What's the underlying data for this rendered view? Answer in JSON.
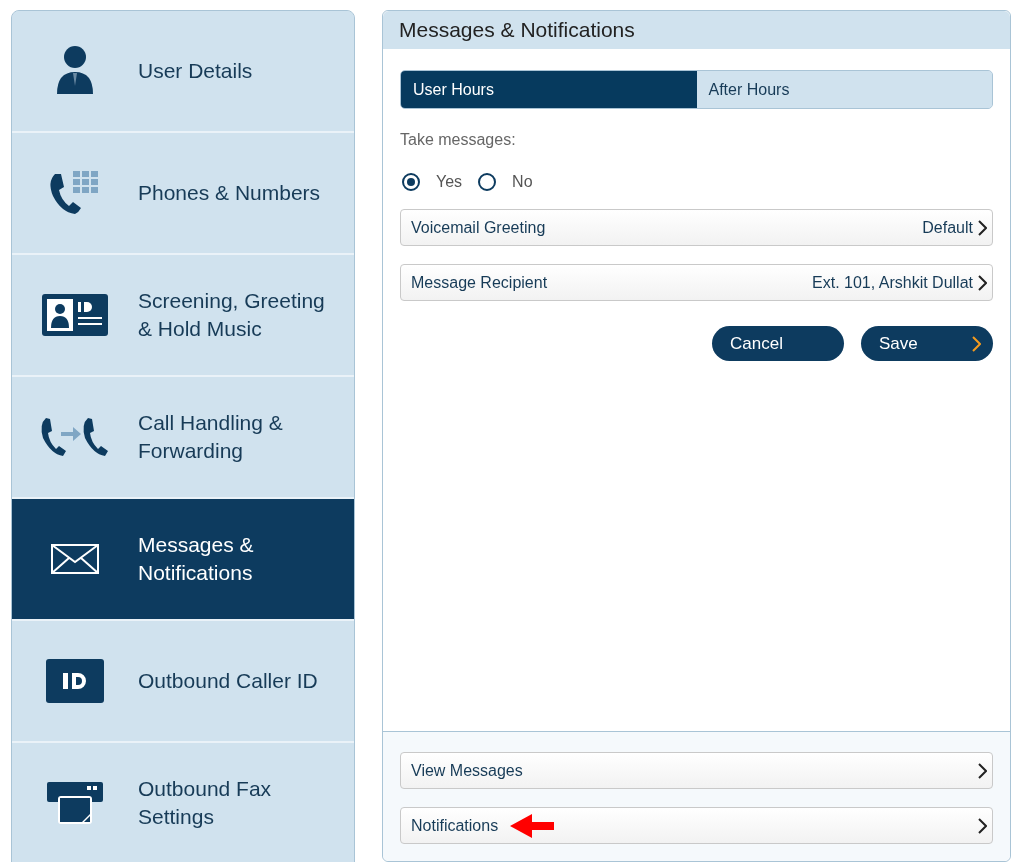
{
  "sidebar": {
    "items": [
      {
        "label": "User Details",
        "selected": false
      },
      {
        "label": "Phones & Numbers",
        "selected": false
      },
      {
        "label": "Screening, Greeting & Hold Music",
        "selected": false
      },
      {
        "label": "Call Handling & Forwarding",
        "selected": false
      },
      {
        "label": "Messages & Notifications",
        "selected": true
      },
      {
        "label": "Outbound Caller ID",
        "selected": false
      },
      {
        "label": "Outbound Fax Settings",
        "selected": false
      }
    ]
  },
  "panel": {
    "title": "Messages & Notifications",
    "tabs": [
      {
        "label": "User Hours",
        "selected": true
      },
      {
        "label": "After Hours",
        "selected": false
      }
    ],
    "take_messages": {
      "label": "Take messages:",
      "options": [
        {
          "label": "Yes",
          "selected": true
        },
        {
          "label": "No",
          "selected": false
        }
      ]
    },
    "settings": [
      {
        "label": "Voicemail Greeting",
        "value": "Default"
      },
      {
        "label": "Message Recipient",
        "value": "Ext. 101, Arshkit Dullat"
      }
    ],
    "buttons": [
      {
        "label": "Cancel",
        "kind": "plain"
      },
      {
        "label": "Save",
        "kind": "next"
      }
    ],
    "links": [
      {
        "label": "View Messages",
        "annotated": false
      },
      {
        "label": "Notifications",
        "annotated": true
      }
    ]
  }
}
